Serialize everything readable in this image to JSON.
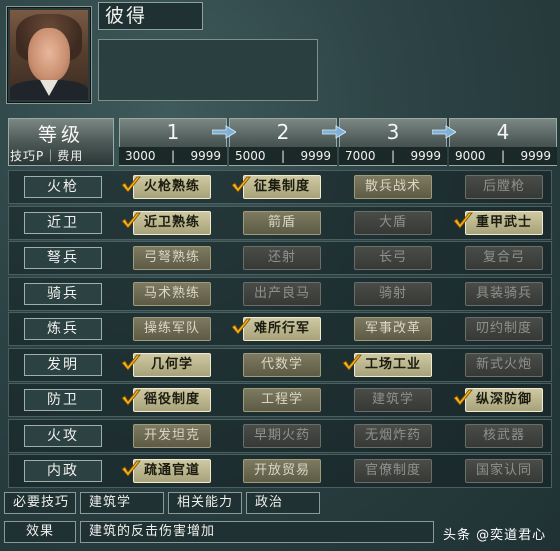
{
  "character": {
    "name": "彼得"
  },
  "header": {
    "level_title": "等级",
    "level_sub": "技巧P｜费用",
    "tiers": [
      {
        "num": "1",
        "cost": "3000",
        "max": "9999"
      },
      {
        "num": "2",
        "cost": "5000",
        "max": "9999"
      },
      {
        "num": "3",
        "cost": "7000",
        "max": "9999"
      },
      {
        "num": "4",
        "cost": "9000",
        "max": "9999"
      }
    ]
  },
  "rows": [
    {
      "category": "火枪",
      "techs": [
        {
          "label": "火枪熟练",
          "state": "done",
          "checked": true
        },
        {
          "label": "征集制度",
          "state": "done",
          "checked": true
        },
        {
          "label": "散兵战术",
          "state": "avail",
          "checked": false
        },
        {
          "label": "后膛枪",
          "state": "lock",
          "checked": false
        }
      ]
    },
    {
      "category": "近卫",
      "techs": [
        {
          "label": "近卫熟练",
          "state": "done",
          "checked": true
        },
        {
          "label": "箭盾",
          "state": "avail",
          "checked": false
        },
        {
          "label": "大盾",
          "state": "lock",
          "checked": false
        },
        {
          "label": "重甲武士",
          "state": "done",
          "checked": true
        }
      ]
    },
    {
      "category": "弩兵",
      "techs": [
        {
          "label": "弓弩熟练",
          "state": "avail",
          "checked": false
        },
        {
          "label": "还射",
          "state": "lock",
          "checked": false
        },
        {
          "label": "长弓",
          "state": "lock",
          "checked": false
        },
        {
          "label": "复合弓",
          "state": "lock",
          "checked": false
        }
      ]
    },
    {
      "category": "骑兵",
      "techs": [
        {
          "label": "马术熟练",
          "state": "avail",
          "checked": false
        },
        {
          "label": "出产良马",
          "state": "lock",
          "checked": false
        },
        {
          "label": "骑射",
          "state": "lock",
          "checked": false
        },
        {
          "label": "具装骑兵",
          "state": "lock",
          "checked": false
        }
      ]
    },
    {
      "category": "炼兵",
      "techs": [
        {
          "label": "操练军队",
          "state": "avail",
          "checked": false
        },
        {
          "label": "难所行军",
          "state": "done",
          "checked": true
        },
        {
          "label": "军事改革",
          "state": "avail",
          "checked": false
        },
        {
          "label": "叨约制度",
          "state": "lock",
          "checked": false
        }
      ]
    },
    {
      "category": "发明",
      "techs": [
        {
          "label": "几何学",
          "state": "done",
          "checked": true
        },
        {
          "label": "代数学",
          "state": "avail",
          "checked": false
        },
        {
          "label": "工场工业",
          "state": "done",
          "checked": true
        },
        {
          "label": "新式火炮",
          "state": "lock",
          "checked": false
        }
      ]
    },
    {
      "category": "防卫",
      "techs": [
        {
          "label": "徭役制度",
          "state": "done",
          "checked": true
        },
        {
          "label": "工程学",
          "state": "avail",
          "checked": false
        },
        {
          "label": "建筑学",
          "state": "lock",
          "checked": false
        },
        {
          "label": "纵深防御",
          "state": "done",
          "checked": true
        }
      ]
    },
    {
      "category": "火攻",
      "techs": [
        {
          "label": "开发坦克",
          "state": "avail",
          "checked": false
        },
        {
          "label": "早期火药",
          "state": "lock",
          "checked": false
        },
        {
          "label": "无烟炸药",
          "state": "lock",
          "checked": false
        },
        {
          "label": "核武器",
          "state": "lock",
          "checked": false
        }
      ]
    },
    {
      "category": "内政",
      "techs": [
        {
          "label": "疏通官道",
          "state": "done",
          "checked": true
        },
        {
          "label": "开放贸易",
          "state": "avail",
          "checked": false
        },
        {
          "label": "官僚制度",
          "state": "lock",
          "checked": false
        },
        {
          "label": "国家认同",
          "state": "lock",
          "checked": false
        }
      ]
    }
  ],
  "bottom": {
    "required_label": "必要技巧",
    "required_value": "建筑学",
    "related_label": "相关能力",
    "related_value": "政治",
    "effect_label": "效果",
    "effect_value": "建筑的反击伤害增加"
  },
  "watermark": "头条 @奕道君心"
}
